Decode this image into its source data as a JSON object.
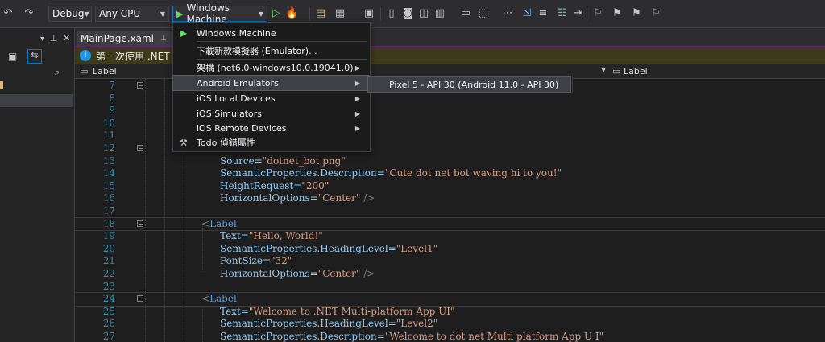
{
  "toolbar": {
    "configuration": "Debug",
    "platform": "Any CPU",
    "run_target": "Windows Machine",
    "icons": [
      "undo-icon",
      "redo-icon",
      "start-without-debug-icon",
      "hot-reload-icon",
      "solution-icon",
      "layout-icon",
      "window-icon",
      "device-icon",
      "screenshot-icon",
      "toggle-icon",
      "bookmark-icon"
    ]
  },
  "left_panel": {
    "icons": [
      "pin-icon",
      "close-icon",
      "collapse-icon",
      "sync-icon",
      "search-icon"
    ]
  },
  "tabs": [
    {
      "label": "MainPage.xaml"
    }
  ],
  "infobar": {
    "text": "第一次使用 .NET MA"
  },
  "navbar": {
    "left_label": "Label",
    "right_label": "Label"
  },
  "dropdown": {
    "items": [
      {
        "label": "Windows Machine",
        "has_submenu": false,
        "icon": "play-icon"
      },
      {
        "label": "下載新款模擬器 (Emulator)...",
        "has_submenu": false,
        "icon": ""
      },
      {
        "label": "架構 (net6.0-windows10.0.19041.0)",
        "has_submenu": true,
        "icon": ""
      },
      {
        "label": "Android Emulators",
        "has_submenu": true,
        "icon": ""
      },
      {
        "label": "iOS Local Devices",
        "has_submenu": true,
        "icon": ""
      },
      {
        "label": "iOS Simulators",
        "has_submenu": true,
        "icon": ""
      },
      {
        "label": "iOS Remote Devices",
        "has_submenu": true,
        "icon": ""
      },
      {
        "label": "Todo 偵錯屬性",
        "has_submenu": false,
        "icon": "wrench-icon"
      }
    ],
    "submenu_items": [
      {
        "label": "Pixel 5 - API 30 (Android 11.0 - API 30)"
      }
    ]
  },
  "code_lines": [
    {
      "num": "7",
      "text": ""
    },
    {
      "num": "8",
      "text": ""
    },
    {
      "num": "9",
      "text": ""
    },
    {
      "num": "10",
      "text": ""
    },
    {
      "num": "11",
      "text": ""
    },
    {
      "num": "12",
      "text": ""
    },
    {
      "num": "13",
      "attr": "Source",
      "val": "\"dotnet_bot.png\""
    },
    {
      "num": "14",
      "attr": "SemanticProperties.Description",
      "val": "\"Cute dot net bot waving hi to you!\""
    },
    {
      "num": "15",
      "attr": "HeightRequest",
      "val": "\"200\""
    },
    {
      "num": "16",
      "attr": "HorizontalOptions",
      "val": "\"Center\"",
      "end": " />"
    },
    {
      "num": "17",
      "text": ""
    },
    {
      "num": "18",
      "tag": "Label"
    },
    {
      "num": "19",
      "attr": "Text",
      "val": "\"Hello, World!\""
    },
    {
      "num": "20",
      "attr": "SemanticProperties.HeadingLevel",
      "val": "\"Level1\""
    },
    {
      "num": "21",
      "attr": "FontSize",
      "val": "\"32\""
    },
    {
      "num": "22",
      "attr": "HorizontalOptions",
      "val": "\"Center\"",
      "end": " />"
    },
    {
      "num": "23",
      "text": ""
    },
    {
      "num": "24",
      "tag": "Label"
    },
    {
      "num": "25",
      "attr": "Text",
      "val": "\"Welcome to .NET Multi-platform App UI\""
    },
    {
      "num": "26",
      "attr": "SemanticProperties.HeadingLevel",
      "val": "\"Level2\""
    },
    {
      "num": "27",
      "attr": "SemanticProperties.Description",
      "val": "\"Welcome to dot net Multi platform App U I\""
    }
  ]
}
